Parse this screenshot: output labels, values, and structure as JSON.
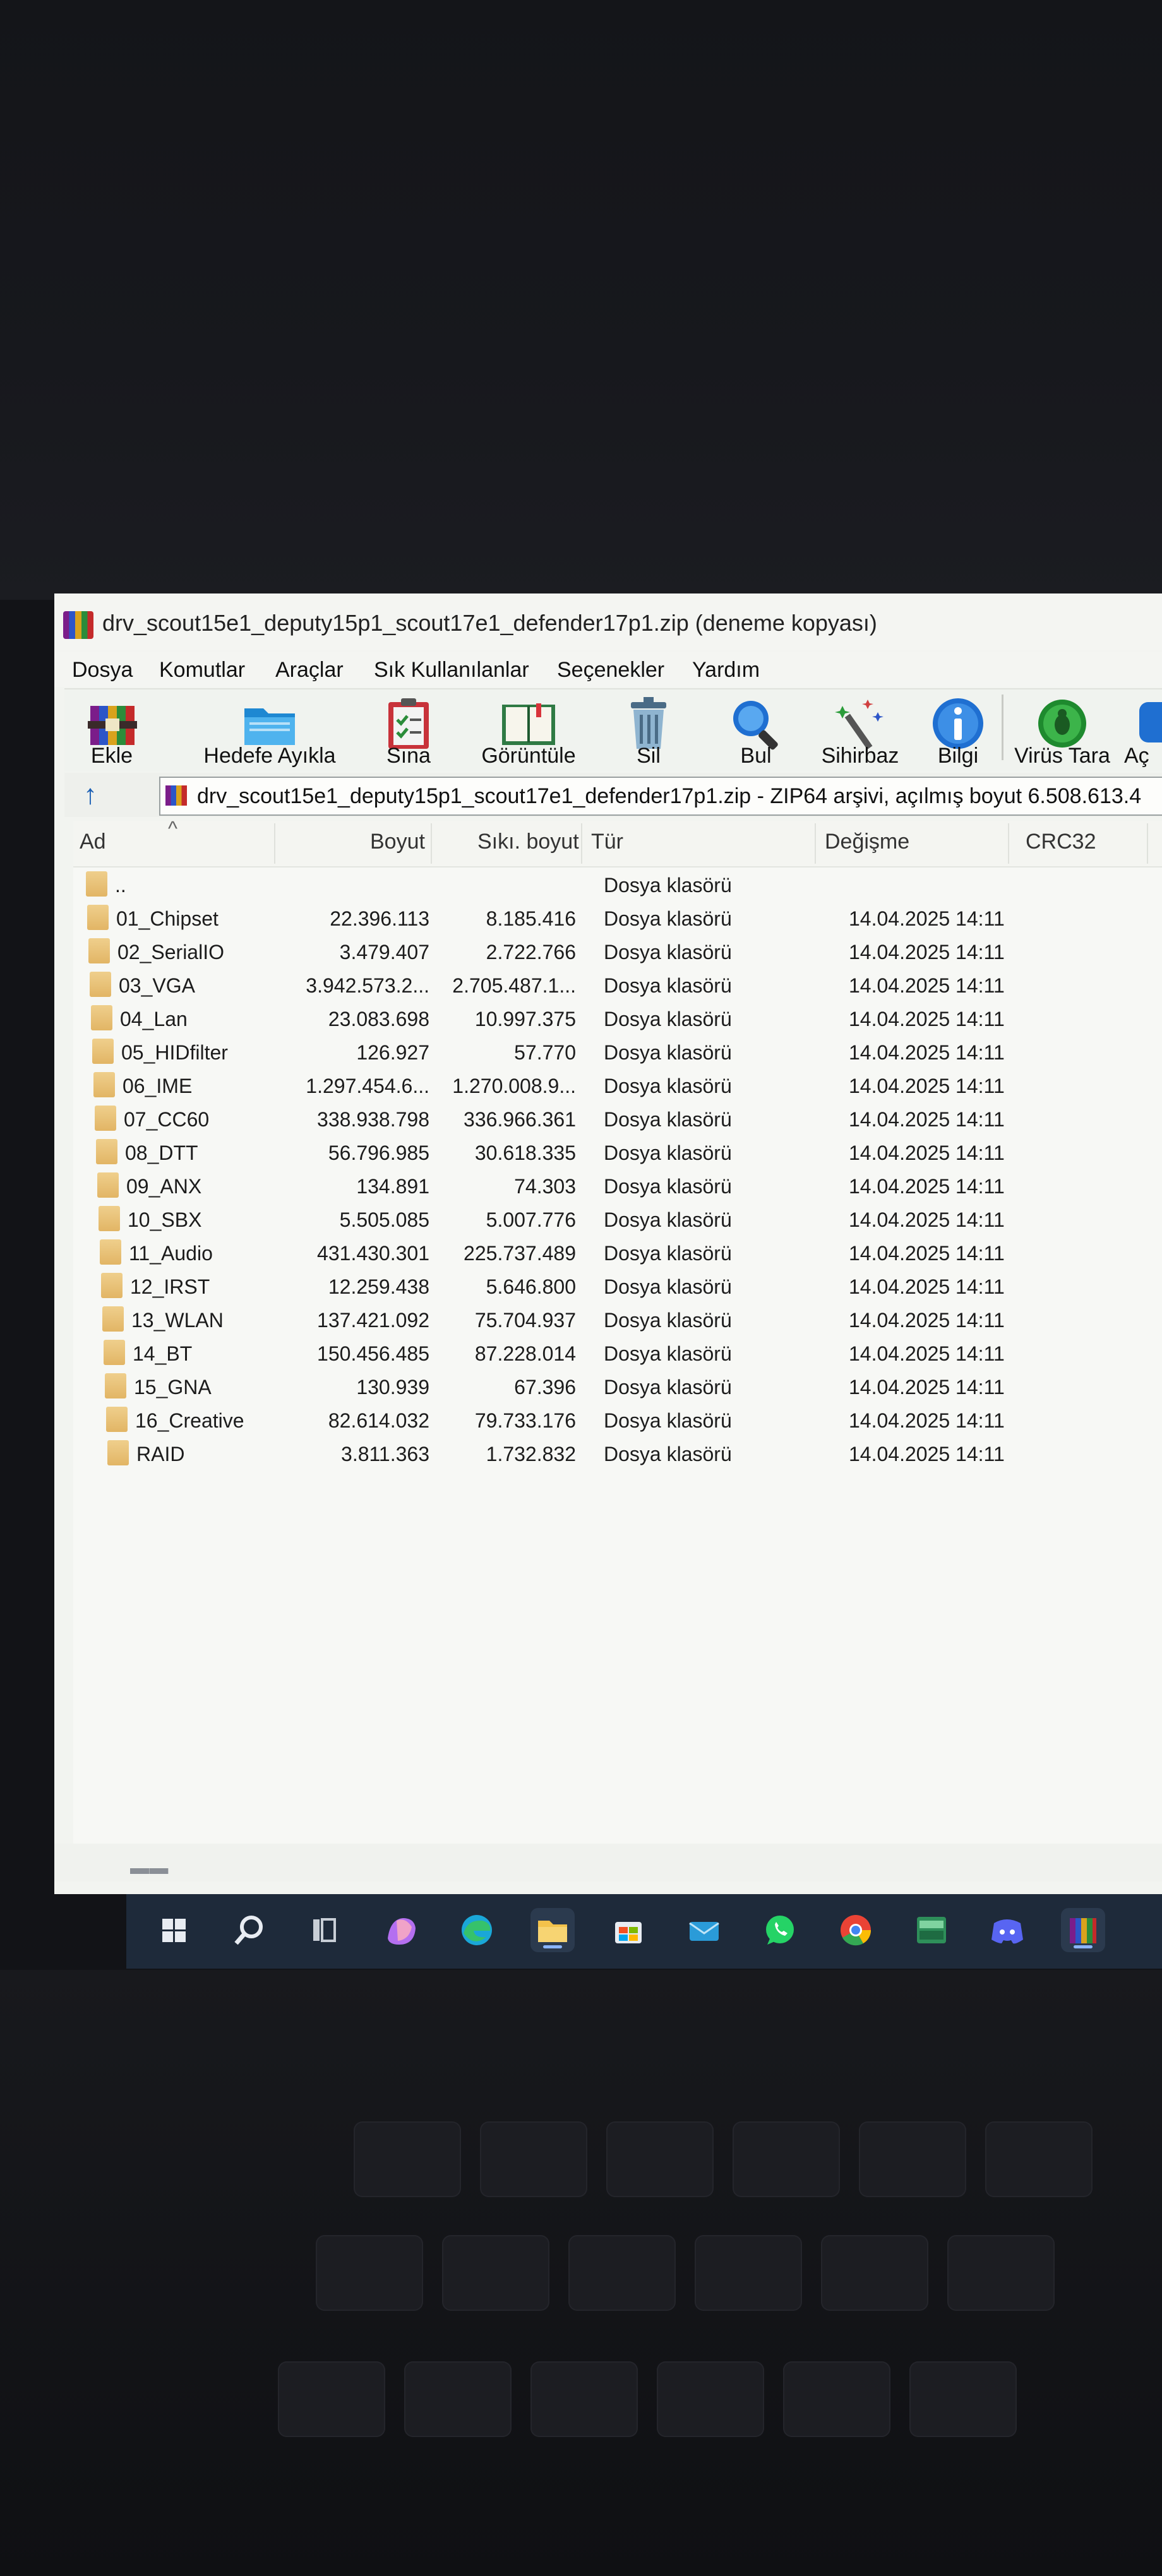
{
  "window": {
    "title": "drv_scout15e1_deputy15p1_scout17e1_defender17p1.zip (deneme kopyası)"
  },
  "menu": [
    "Dosya",
    "Komutlar",
    "Araçlar",
    "Sık Kullanılanlar",
    "Seçenekler",
    "Yardım"
  ],
  "toolbar": [
    {
      "label": "Ekle",
      "icon": "archive-add-icon"
    },
    {
      "label": "Hedefe Ayıkla",
      "icon": "folder-extract-icon"
    },
    {
      "label": "Sına",
      "icon": "clipboard-test-icon"
    },
    {
      "label": "Görüntüle",
      "icon": "book-view-icon"
    },
    {
      "label": "Sil",
      "icon": "trash-icon"
    },
    {
      "label": "Bul",
      "icon": "magnifier-icon"
    },
    {
      "label": "Sihirbaz",
      "icon": "magic-wand-icon"
    },
    {
      "label": "Bilgi",
      "icon": "info-icon"
    },
    {
      "label": "Virüs Tara",
      "icon": "virus-scan-icon"
    },
    {
      "label": "Aç",
      "icon": "comment-icon"
    }
  ],
  "address": {
    "text": "drv_scout15e1_deputy15p1_scout17e1_defender17p1.zip - ZIP64 arşivi, açılmış boyut 6.508.613.4"
  },
  "columns": {
    "name": "Ad",
    "size": "Boyut",
    "packed": "Sıkı. boyut",
    "type": "Tür",
    "modified": "Değişme",
    "crc": "CRC32"
  },
  "files": [
    {
      "name": "..",
      "size": "",
      "packed": "",
      "type": "Dosya klasörü",
      "modified": ""
    },
    {
      "name": "01_Chipset",
      "size": "22.396.113",
      "packed": "8.185.416",
      "type": "Dosya klasörü",
      "modified": "14.04.2025 14:11"
    },
    {
      "name": "02_SerialIO",
      "size": "3.479.407",
      "packed": "2.722.766",
      "type": "Dosya klasörü",
      "modified": "14.04.2025 14:11"
    },
    {
      "name": "03_VGA",
      "size": "3.942.573.2...",
      "packed": "2.705.487.1...",
      "type": "Dosya klasörü",
      "modified": "14.04.2025 14:11"
    },
    {
      "name": "04_Lan",
      "size": "23.083.698",
      "packed": "10.997.375",
      "type": "Dosya klasörü",
      "modified": "14.04.2025 14:11"
    },
    {
      "name": "05_HIDfilter",
      "size": "126.927",
      "packed": "57.770",
      "type": "Dosya klasörü",
      "modified": "14.04.2025 14:11"
    },
    {
      "name": "06_IME",
      "size": "1.297.454.6...",
      "packed": "1.270.008.9...",
      "type": "Dosya klasörü",
      "modified": "14.04.2025 14:11"
    },
    {
      "name": "07_CC60",
      "size": "338.938.798",
      "packed": "336.966.361",
      "type": "Dosya klasörü",
      "modified": "14.04.2025 14:11"
    },
    {
      "name": "08_DTT",
      "size": "56.796.985",
      "packed": "30.618.335",
      "type": "Dosya klasörü",
      "modified": "14.04.2025 14:11"
    },
    {
      "name": "09_ANX",
      "size": "134.891",
      "packed": "74.303",
      "type": "Dosya klasörü",
      "modified": "14.04.2025 14:11"
    },
    {
      "name": "10_SBX",
      "size": "5.505.085",
      "packed": "5.007.776",
      "type": "Dosya klasörü",
      "modified": "14.04.2025 14:11"
    },
    {
      "name": "11_Audio",
      "size": "431.430.301",
      "packed": "225.737.489",
      "type": "Dosya klasörü",
      "modified": "14.04.2025 14:11"
    },
    {
      "name": "12_IRST",
      "size": "12.259.438",
      "packed": "5.646.800",
      "type": "Dosya klasörü",
      "modified": "14.04.2025 14:11"
    },
    {
      "name": "13_WLAN",
      "size": "137.421.092",
      "packed": "75.704.937",
      "type": "Dosya klasörü",
      "modified": "14.04.2025 14:11"
    },
    {
      "name": "14_BT",
      "size": "150.456.485",
      "packed": "87.228.014",
      "type": "Dosya klasörü",
      "modified": "14.04.2025 14:11"
    },
    {
      "name": "15_GNA",
      "size": "130.939",
      "packed": "67.396",
      "type": "Dosya klasörü",
      "modified": "14.04.2025 14:11"
    },
    {
      "name": "16_Creative",
      "size": "82.614.032",
      "packed": "79.733.176",
      "type": "Dosya klasörü",
      "modified": "14.04.2025 14:11"
    },
    {
      "name": "RAID",
      "size": "3.811.363",
      "packed": "1.732.832",
      "type": "Dosya klasörü",
      "modified": "14.04.2025 14:11"
    }
  ],
  "taskbar": [
    {
      "name": "start-button",
      "icon": "windows-icon",
      "color": "#ffffff"
    },
    {
      "name": "search-button",
      "icon": "search-icon",
      "color": "#ffffff"
    },
    {
      "name": "task-view-button",
      "icon": "task-view-icon",
      "color": "#d0d4da"
    },
    {
      "name": "copilot-button",
      "icon": "copilot-icon",
      "color": "#c77dff"
    },
    {
      "name": "edge-button",
      "icon": "edge-icon",
      "color": "#23a6d5"
    },
    {
      "name": "file-explorer-button",
      "icon": "folder-icon",
      "color": "#f3c24b"
    },
    {
      "name": "store-button",
      "icon": "store-icon",
      "color": "#f5a623"
    },
    {
      "name": "mail-button",
      "icon": "mail-icon",
      "color": "#2a9bd8"
    },
    {
      "name": "whatsapp-button",
      "icon": "whatsapp-icon",
      "color": "#25d366"
    },
    {
      "name": "chrome-button",
      "icon": "chrome-icon",
      "color": "#ea4335"
    },
    {
      "name": "app-button",
      "icon": "app-icon",
      "color": "#3ea86a"
    },
    {
      "name": "discord-button",
      "icon": "discord-icon",
      "color": "#5865f2"
    },
    {
      "name": "winrar-button",
      "icon": "winrar-icon",
      "color": "#8a3fa0"
    }
  ]
}
